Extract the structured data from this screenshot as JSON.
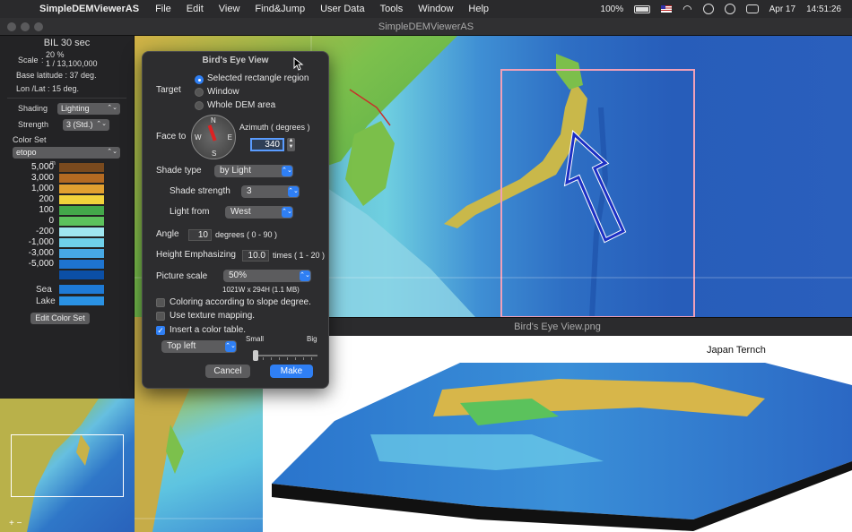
{
  "menubar": {
    "app_name": "SimpleDEMViewerAS",
    "menus": [
      "File",
      "Edit",
      "View",
      "Find&Jump",
      "User Data",
      "Tools",
      "Window",
      "Help"
    ],
    "battery": "100%",
    "date": "Apr 17",
    "time": "14:51:26"
  },
  "window": {
    "title": "SimpleDEMViewerAS"
  },
  "left_panel": {
    "dataset": "BIL 30 sec",
    "scale_label": "Scale",
    "scale_percent": "20 %",
    "scale_ratio": "1 / 13,100,000",
    "base_latitude": "Base latitude : 37 deg.",
    "lon_lat": "Lon /Lat : 15 deg.",
    "shading_label": "Shading",
    "shading_value": "Lighting",
    "strength_label": "Strength",
    "strength_value": "3 (Std.)",
    "color_set_label": "Color Set",
    "color_set_value": "etopo",
    "legend_unit": "m",
    "legend": [
      {
        "label": "5,000",
        "color": "#7a4a1e"
      },
      {
        "label": "3,000",
        "color": "#b46a22"
      },
      {
        "label": "1,000",
        "color": "#e1a030"
      },
      {
        "label": "200",
        "color": "#f1d23b"
      },
      {
        "label": "100",
        "color": "#43a84a"
      },
      {
        "label": "0",
        "color": "#5cc25c"
      },
      {
        "label": "-200",
        "color": "#9fe6f0"
      },
      {
        "label": "-1,000",
        "color": "#6fd0ea"
      },
      {
        "label": "-3,000",
        "color": "#47a8e4"
      },
      {
        "label": "-5,000",
        "color": "#1e74d0"
      },
      {
        "label": "",
        "color": "#0b4fa6"
      }
    ],
    "sea_label": "Sea",
    "sea_color": "#1e7ad6",
    "lake_label": "Lake",
    "lake_color": "#2a92e4",
    "edit_button": "Edit Color Set"
  },
  "minimap": {
    "zoom_controls": "+ −"
  },
  "dialog": {
    "title": "Bird's Eye View",
    "target_label": "Target",
    "target_options": [
      "Selected rectangle region",
      "Window",
      "Whole DEM area"
    ],
    "face_to_label": "Face to",
    "compass": {
      "n": "N",
      "e": "E",
      "s": "S",
      "w": "W"
    },
    "azimuth_label": "Azimuth ( degrees )",
    "azimuth_value": "340",
    "shade_type_label": "Shade type",
    "shade_type_value": "by Light",
    "shade_strength_label": "Shade strength",
    "shade_strength_value": "3",
    "light_from_label": "Light from",
    "light_from_value": "West",
    "angle_label": "Angle",
    "angle_value": "10",
    "angle_hint": "degrees ( 0 - 90 )",
    "height_label": "Height Emphasizing",
    "height_value": "10.0",
    "height_hint": "times ( 1 - 20 )",
    "picture_scale_label": "Picture scale",
    "picture_scale_value": "50%",
    "picture_size": "1021W x 294H (1.1 MB)",
    "coloring_slope": "Coloring according to slope degree.",
    "texture_mapping": "Use texture mapping.",
    "insert_color_table": "Insert a color table.",
    "table_position": "Top left",
    "size_small": "Small",
    "size_big": "Big",
    "cancel": "Cancel",
    "make": "Make"
  },
  "image_window": {
    "title": "Bird's Eye View.png",
    "caption": "Japan Ternch"
  }
}
